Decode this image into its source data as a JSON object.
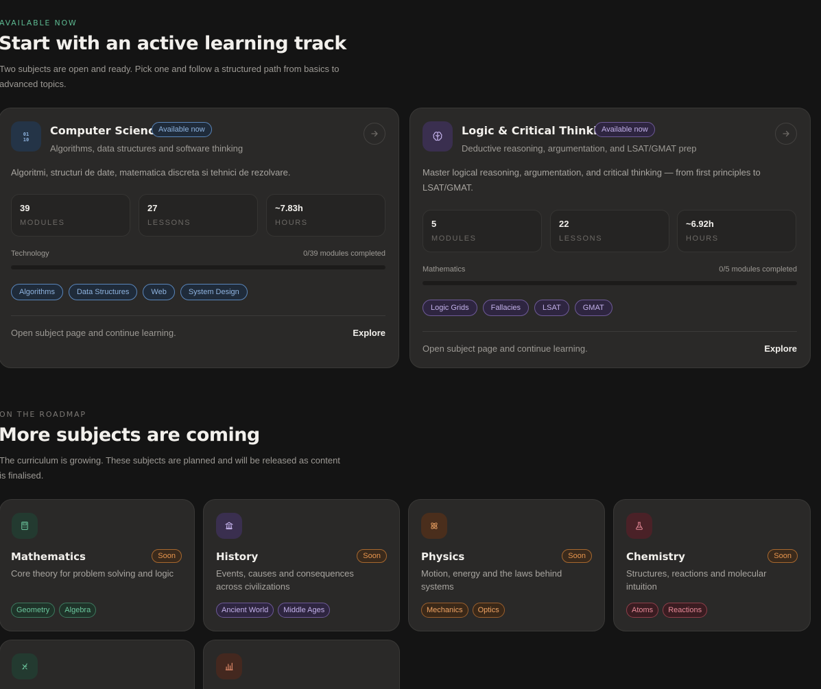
{
  "available": {
    "eyebrow": "AVAILABLE NOW",
    "heading": "Start with an active learning track",
    "lead": "Two subjects are open and ready. Pick one and follow a structured path from basics to advanced topics."
  },
  "tracks": [
    {
      "title": "Computer Science",
      "status": "Available now",
      "subtitle": "Algorithms, data structures and software thinking",
      "description": "Algoritmi, structuri de date, matematica discreta si tehnici de rezolvare.",
      "stats": [
        {
          "value": "39",
          "label": "MODULES"
        },
        {
          "value": "27",
          "label": "LESSONS"
        },
        {
          "value": "~7.83h",
          "label": "HOURS"
        }
      ],
      "category": "Technology",
      "progress_text": "0/39 modules completed",
      "progress": 0,
      "tags": [
        "Algorithms",
        "Data Structures",
        "Web",
        "System Design"
      ],
      "footnote": "Open subject page and continue learning.",
      "cta": "Explore",
      "icon": "binary-icon",
      "accent": "#6a9cd6"
    },
    {
      "title": "Logic & Critical Thinking",
      "status": "Available now",
      "subtitle": "Deductive reasoning, argumentation, and LSAT/GMAT prep",
      "description": "Master logical reasoning, argumentation, and critical thinking — from first principles to LSAT/GMAT.",
      "stats": [
        {
          "value": "5",
          "label": "MODULES"
        },
        {
          "value": "22",
          "label": "LESSONS"
        },
        {
          "value": "~6.92h",
          "label": "HOURS"
        }
      ],
      "category": "Mathematics",
      "progress_text": "0/5 modules completed",
      "progress": 0,
      "tags": [
        "Logic Grids",
        "Fallacies",
        "LSAT",
        "GMAT"
      ],
      "footnote": "Open subject page and continue learning.",
      "cta": "Explore",
      "icon": "brain-icon",
      "accent": "#a389d6"
    }
  ],
  "roadmap": {
    "eyebrow": "ON THE ROADMAP",
    "heading": "More subjects are coming",
    "lead": "The curriculum is growing. These subjects are planned and will be released as content is finalised."
  },
  "upcoming": [
    {
      "title": "Mathematics",
      "badge": "Soon",
      "description": "Core theory for problem solving and logic",
      "tags": [
        "Geometry",
        "Algebra"
      ],
      "icon": "calculator-icon",
      "accent": "#56b38a"
    },
    {
      "title": "History",
      "badge": "Soon",
      "description": "Events, causes and consequences across civilizations",
      "tags": [
        "Ancient World",
        "Middle Ages"
      ],
      "icon": "landmark-icon",
      "accent": "#a389d6"
    },
    {
      "title": "Physics",
      "badge": "Soon",
      "description": "Motion, energy and the laws behind systems",
      "tags": [
        "Mechanics",
        "Optics"
      ],
      "icon": "atom-icon",
      "accent": "#e8964e"
    },
    {
      "title": "Chemistry",
      "badge": "Soon",
      "description": "Structures, reactions and molecular intuition",
      "tags": [
        "Atoms",
        "Reactions"
      ],
      "icon": "flask-icon",
      "accent": "#d96a7a"
    }
  ],
  "partial": [
    {
      "icon": "dna-icon",
      "accent": "#56b38a"
    },
    {
      "icon": "bar-chart-icon",
      "accent": "#e07a56"
    }
  ]
}
